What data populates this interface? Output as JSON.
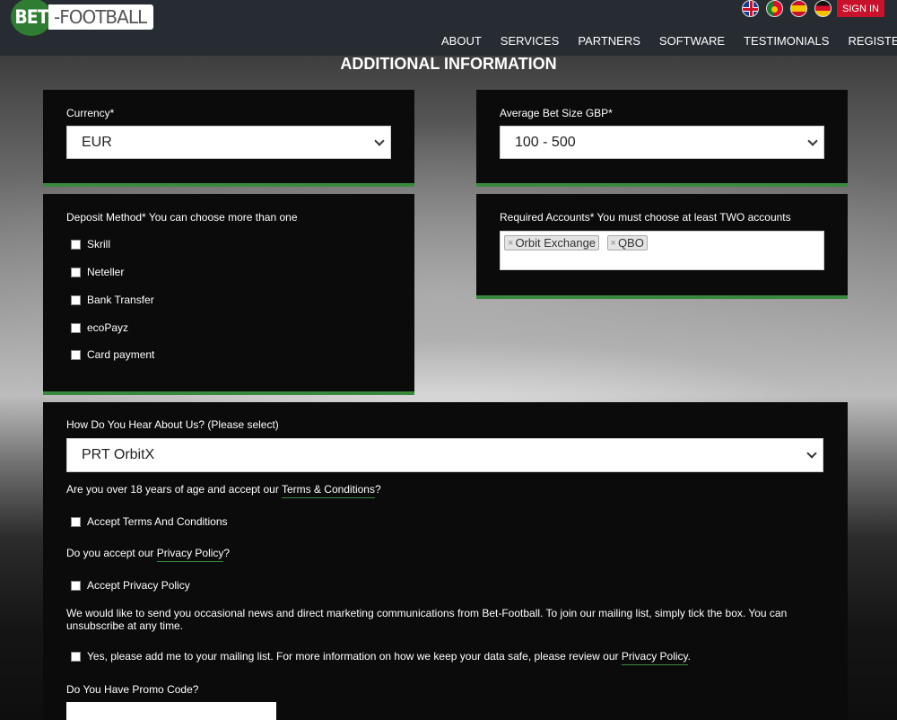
{
  "header": {
    "logo_mark": "BET",
    "logo_text": "-FOOTBALL",
    "signin_label": "SIGN IN",
    "flags": [
      "uk-flag-icon",
      "portugal-flag-icon",
      "spain-flag-icon",
      "germany-flag-icon"
    ],
    "nav": [
      "ABOUT",
      "SERVICES",
      "PARTNERS",
      "SOFTWARE",
      "TESTIMONIALS",
      "REGISTER"
    ]
  },
  "page": {
    "title": "ADDITIONAL INFORMATION"
  },
  "currency": {
    "label": "Currency*",
    "value": "EUR"
  },
  "bet_size": {
    "label": "Average Bet Size GBP*",
    "value": "100 - 500"
  },
  "deposit": {
    "label": "Deposit Method* You can choose more than one",
    "options": [
      "Skrill",
      "Neteller",
      "Bank Transfer",
      "ecoPayz",
      "Card payment"
    ]
  },
  "accounts": {
    "label": "Required Accounts* You must choose at least TWO accounts",
    "tags": [
      "Orbit Exchange",
      "QBO"
    ],
    "remove_symbol": "×"
  },
  "hear": {
    "label": "How Do You Hear About Us? (Please select)",
    "value": "PRT OrbitX"
  },
  "terms": {
    "question_prefix": "Are you over 18 years of age and accept our ",
    "question_link": "Terms & Conditions",
    "question_suffix": "?",
    "checkbox": "Accept Terms And Conditions"
  },
  "privacy": {
    "question_prefix": "Do you accept our ",
    "question_link": "Privacy Policy",
    "question_suffix": "?",
    "checkbox": "Accept Privacy Policy"
  },
  "marketing": {
    "text": "We would like to send you occasional news and direct marketing communications from Bet-Football. To join our mailing list, simply tick the box. You can unsubscribe at any time.",
    "checkbox_prefix": "Yes, please add me to your mailing list. For more information on how we keep your data safe, please review our ",
    "checkbox_link": "Privacy Policy",
    "checkbox_suffix": "."
  },
  "promo": {
    "label": "Do You Have Promo Code?",
    "value": ""
  },
  "colors": {
    "accent_green": "#3a8a3e",
    "signin_red": "#c8112b",
    "panel": "#0b0b0b"
  }
}
